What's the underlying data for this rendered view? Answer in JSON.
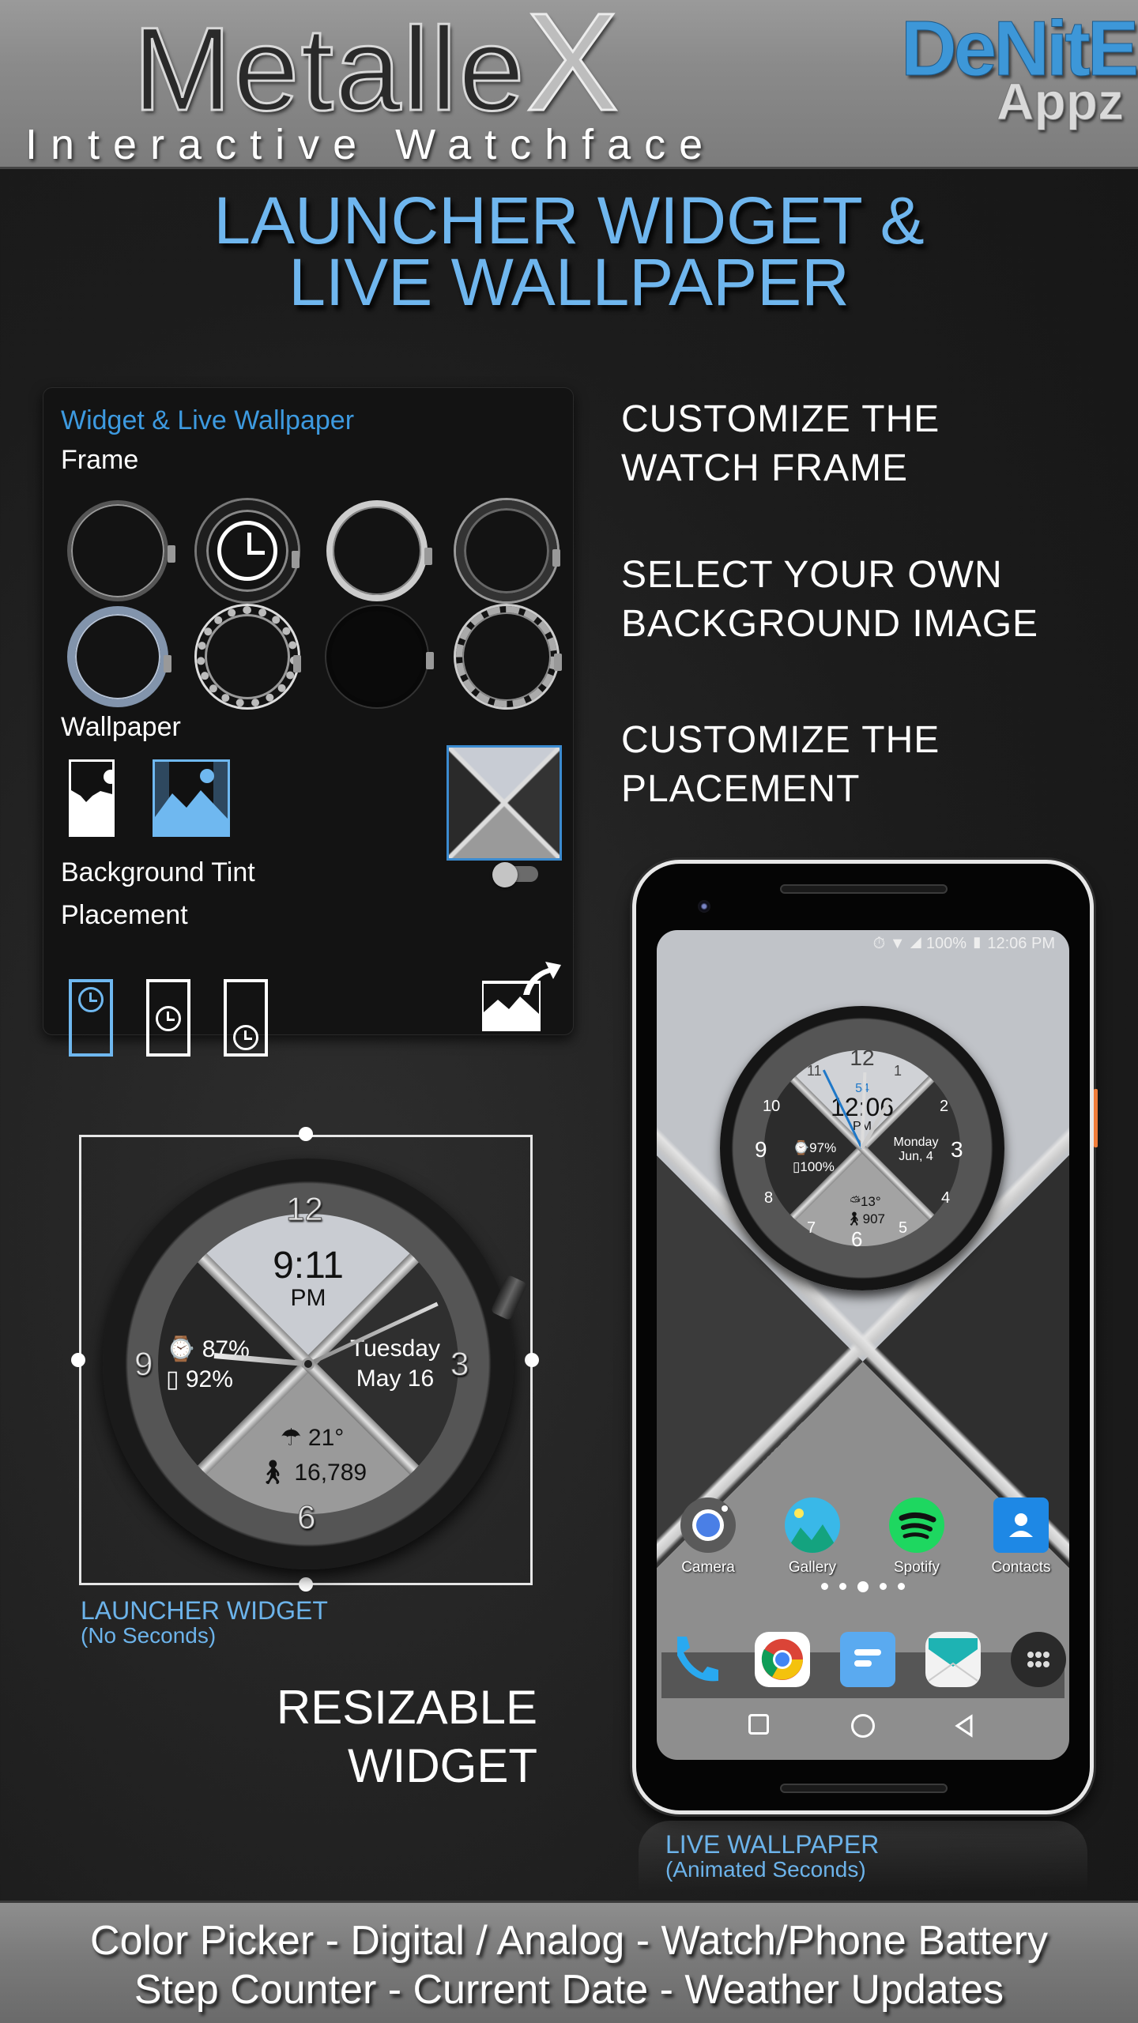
{
  "header": {
    "app_title_main": "Metalle",
    "app_title_x": "X",
    "app_subtitle": "Interactive Watchface",
    "brand_top": "DeNitE!",
    "brand_bottom": "Appz"
  },
  "headline": {
    "line1": "LAUNCHER WIDGET &",
    "line2": "LIVE WALLPAPER"
  },
  "settings_panel": {
    "title": "Widget & Live Wallpaper",
    "frame_label": "Frame",
    "frames": [
      {
        "icon": "watch-frame-bezel-ticks-icon",
        "selected": false
      },
      {
        "icon": "watch-frame-chrono-icon",
        "selected": true
      },
      {
        "icon": "watch-frame-silver-icon",
        "selected": false
      },
      {
        "icon": "watch-frame-black-steel-icon",
        "selected": false
      },
      {
        "icon": "watch-frame-blue-steel-icon",
        "selected": false
      },
      {
        "icon": "watch-frame-diamond-icon",
        "selected": false
      },
      {
        "icon": "watch-frame-black-icon",
        "selected": false
      },
      {
        "icon": "watch-frame-knurled-icon",
        "selected": false
      }
    ],
    "wallpaper_label": "Wallpaper",
    "wallpaper_options": [
      {
        "icon": "wallpaper-fit-icon",
        "selected": false
      },
      {
        "icon": "wallpaper-fill-icon",
        "selected": true
      }
    ],
    "wallpaper_preview_icon": "wallpaper-preview-thumbnail",
    "background_tint_label": "Background Tint",
    "background_tint_on": false,
    "placement_label": "Placement",
    "placement_options": [
      {
        "icon": "placement-top-icon",
        "selected": true
      },
      {
        "icon": "placement-center-icon",
        "selected": false
      },
      {
        "icon": "placement-bottom-icon",
        "selected": false
      }
    ],
    "set_wallpaper_icon": "set-wallpaper-icon"
  },
  "features": [
    {
      "line1": "CUSTOMIZE THE",
      "line2": "WATCH FRAME"
    },
    {
      "line1": "SELECT YOUR OWN",
      "line2": "BACKGROUND IMAGE"
    },
    {
      "line1": "CUSTOMIZE THE",
      "line2": "PLACEMENT"
    }
  ],
  "launcher_widget": {
    "time": "9:11",
    "ampm": "PM",
    "watch_battery": "87%",
    "phone_battery": "92%",
    "day": "Tuesday",
    "date": "May 16",
    "temperature": "21°",
    "steps": "16,789",
    "numerals": {
      "n12": "12",
      "n3": "3",
      "n6": "6",
      "n9": "9"
    },
    "caption": "LAUNCHER WIDGET",
    "caption_sub": "(No Seconds)"
  },
  "resizable": {
    "line1": "RESIZABLE",
    "line2": "WIDGET"
  },
  "phone": {
    "statusbar": "⏱ ▼ ◢ 100% ▮ 12:06 PM",
    "watch": {
      "seconds": "54",
      "time": "12:06",
      "ampm": "PM",
      "watch_battery": "97%",
      "phone_battery": "100%",
      "day": "Monday",
      "date": "Jun, 4",
      "temperature": "13°",
      "steps": "907",
      "numerals": [
        "12",
        "1",
        "2",
        "3",
        "4",
        "5",
        "6",
        "7",
        "8",
        "9",
        "10",
        "11"
      ]
    },
    "apps": [
      {
        "label": "Camera",
        "color": "#4a7fe6"
      },
      {
        "label": "Gallery",
        "color": "#39b8e8"
      },
      {
        "label": "Spotify",
        "color": "#1ed760"
      },
      {
        "label": "Contacts",
        "color": "#1e88e5"
      }
    ],
    "page_dots": 5,
    "active_dot": 2,
    "dock": [
      {
        "name": "phone"
      },
      {
        "name": "chrome"
      },
      {
        "name": "messages"
      },
      {
        "name": "email"
      },
      {
        "name": "app-drawer"
      }
    ],
    "caption": "LIVE WALLPAPER",
    "caption_sub": "(Animated Seconds)"
  },
  "footer": {
    "line1": "Color Picker - Digital / Analog - Watch/Phone Battery",
    "line2": "Step Counter - Current Date - Weather Updates"
  },
  "colors": {
    "accent_blue": "#6fb6ee",
    "panel_title_blue": "#3d9ae0",
    "brand_blue": "#3d97d8",
    "phone_button_orange": "#f07d3a"
  }
}
